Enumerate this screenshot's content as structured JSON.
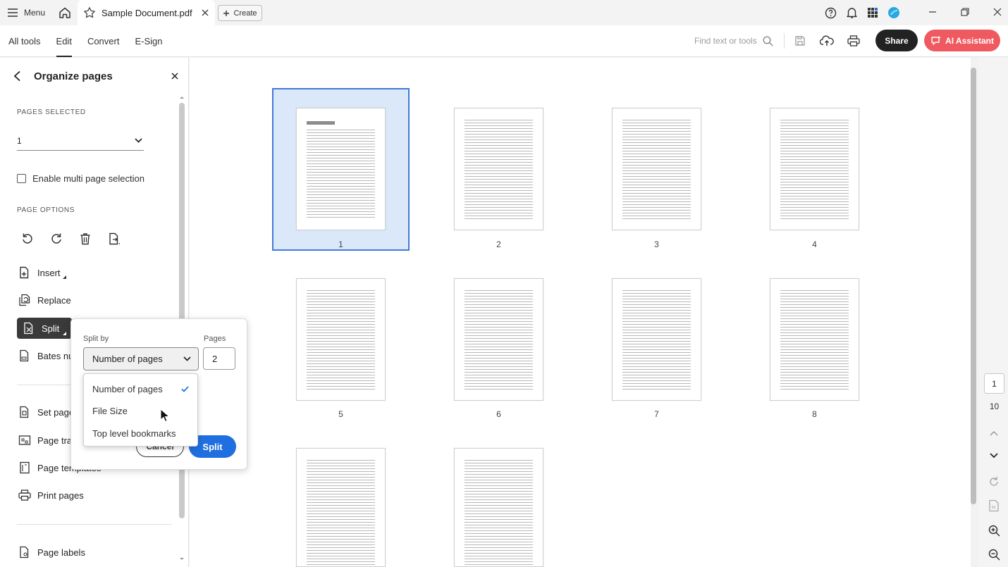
{
  "titlebar": {
    "menu_label": "Menu",
    "tab_title": "Sample Document.pdf",
    "create_label": "Create"
  },
  "toolbar": {
    "nav": [
      "All tools",
      "Edit",
      "Convert",
      "E-Sign"
    ],
    "active_nav": "Edit",
    "find_placeholder": "Find text or tools",
    "share_label": "Share",
    "ai_label": "AI Assistant"
  },
  "panel": {
    "title": "Organize pages",
    "pages_selected_label": "PAGES SELECTED",
    "pages_selected_value": "1",
    "multi_label": "Enable multi page selection",
    "page_options_label": "PAGE OPTIONS",
    "tools": {
      "insert": "Insert",
      "replace": "Replace",
      "split": "Split",
      "bates": "Bates nu",
      "set_page": "Set page",
      "page_transitions": "Page tra",
      "page_templates": "Page templates",
      "print_pages": "Print pages",
      "page_labels": "Page labels"
    }
  },
  "split_popup": {
    "split_by_label": "Split by",
    "pages_label": "Pages",
    "split_by_value": "Number of pages",
    "pages_value": "2",
    "cancel_label": "Cancel",
    "split_label": "Split",
    "options": [
      "Number of pages",
      "File Size",
      "Top level bookmarks"
    ],
    "checked_option": "Number of pages"
  },
  "thumbnails": {
    "numbers": [
      "1",
      "2",
      "3",
      "4",
      "5",
      "6",
      "7",
      "8"
    ],
    "selected": "1"
  },
  "navigator": {
    "current_page": "1",
    "total_pages": "10"
  },
  "colors": {
    "accent_blue": "#1f6fe0",
    "ai_red": "#ef5a60",
    "selection_fill": "#dbe8f9",
    "selection_border": "#3f7ad8"
  }
}
